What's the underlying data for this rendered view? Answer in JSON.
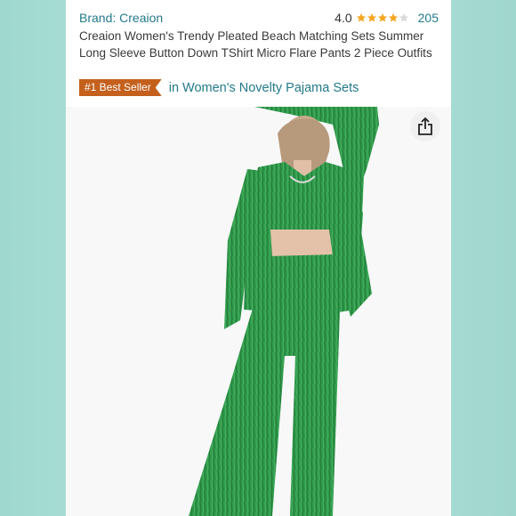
{
  "product": {
    "brand": "Brand: Creaion",
    "rating_value": "4.0",
    "rating_stars": 4,
    "review_count": "205",
    "title": "Creaion Women's Trendy Pleated Beach Matching Sets Summer Long Sleeve Button Down TShirt Micro Flare Pants 2 Piece Outfits",
    "badge": "#1 Best Seller",
    "category": "in Women's Novelty Pajama Sets"
  },
  "icons": {
    "share": "share-icon",
    "star": "star-icon"
  },
  "colors": {
    "link": "#237a8a",
    "badge": "#c4601c",
    "star_fill": "#f5a623",
    "garment_green": "#2f9a4a",
    "side_background": "#a9ddd5"
  }
}
